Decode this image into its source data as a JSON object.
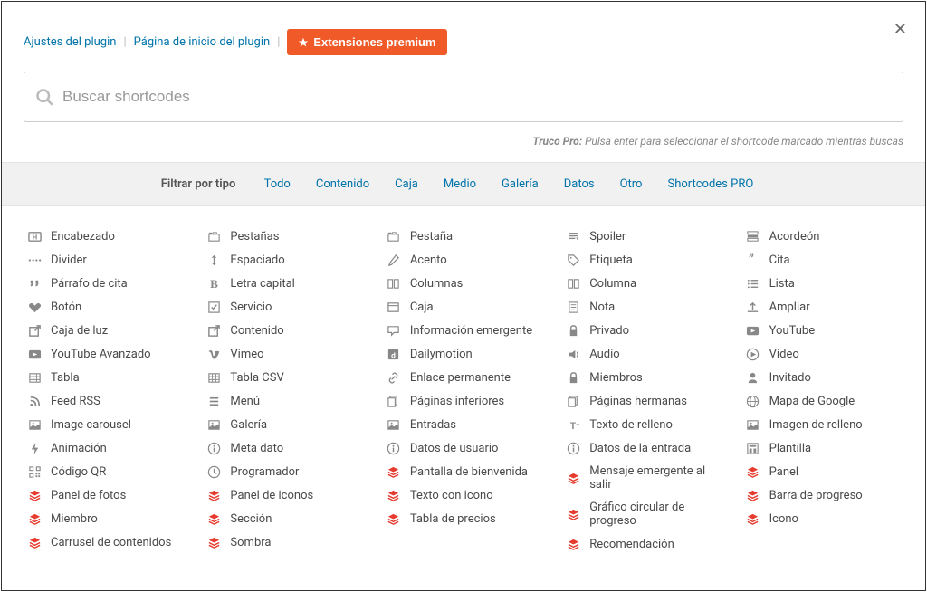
{
  "header": {
    "link_settings": "Ajustes del plugin",
    "link_home": "Página de inicio del plugin",
    "premium_button": "Extensiones premium",
    "search_placeholder": "Buscar shortcodes",
    "tip_label": "Truco Pro:",
    "tip_text": "Pulsa enter para seleccionar el shortcode marcado mientras buscas"
  },
  "filter": {
    "label": "Filtrar por tipo",
    "items": [
      "Todo",
      "Contenido",
      "Caja",
      "Medio",
      "Galería",
      "Datos",
      "Otro",
      "Shortcodes PRO"
    ]
  },
  "columns": [
    [
      {
        "icon": "heading",
        "label": "Encabezado"
      },
      {
        "icon": "divider",
        "label": "Divider"
      },
      {
        "icon": "quote",
        "label": "Párrafo de cita"
      },
      {
        "icon": "heart",
        "label": "Botón"
      },
      {
        "icon": "external",
        "label": "Caja de luz"
      },
      {
        "icon": "youtube",
        "label": "YouTube Avanzado"
      },
      {
        "icon": "table",
        "label": "Tabla"
      },
      {
        "icon": "rss",
        "label": "Feed RSS"
      },
      {
        "icon": "image",
        "label": "Image carousel"
      },
      {
        "icon": "bolt",
        "label": "Animación"
      },
      {
        "icon": "qr",
        "label": "Código QR"
      },
      {
        "icon": "layers",
        "label": "Panel de fotos",
        "red": true
      },
      {
        "icon": "layers",
        "label": "Miembro",
        "red": true
      },
      {
        "icon": "layers",
        "label": "Carrusel de contenidos",
        "red": true
      }
    ],
    [
      {
        "icon": "tabs",
        "label": "Pestañas"
      },
      {
        "icon": "vspace",
        "label": "Espaciado"
      },
      {
        "icon": "bold",
        "label": "Letra capital"
      },
      {
        "icon": "check",
        "label": "Servicio"
      },
      {
        "icon": "external",
        "label": "Contenido"
      },
      {
        "icon": "vimeo",
        "label": "Vimeo"
      },
      {
        "icon": "table",
        "label": "Tabla CSV"
      },
      {
        "icon": "menu",
        "label": "Menú"
      },
      {
        "icon": "image",
        "label": "Galería"
      },
      {
        "icon": "info",
        "label": "Meta dato"
      },
      {
        "icon": "clock",
        "label": "Programador"
      },
      {
        "icon": "layers",
        "label": "Panel de iconos",
        "red": true
      },
      {
        "icon": "layers",
        "label": "Sección",
        "red": true
      },
      {
        "icon": "layers",
        "label": "Sombra",
        "red": true
      }
    ],
    [
      {
        "icon": "tabs",
        "label": "Pestaña"
      },
      {
        "icon": "pencil",
        "label": "Acento"
      },
      {
        "icon": "columns",
        "label": "Columnas"
      },
      {
        "icon": "box",
        "label": "Caja"
      },
      {
        "icon": "comment",
        "label": "Información emergente"
      },
      {
        "icon": "dailymotion",
        "label": "Dailymotion"
      },
      {
        "icon": "link",
        "label": "Enlace permanente"
      },
      {
        "icon": "pages",
        "label": "Páginas inferiores"
      },
      {
        "icon": "image",
        "label": "Entradas"
      },
      {
        "icon": "info",
        "label": "Datos de usuario"
      },
      {
        "icon": "layers",
        "label": "Pantalla de bienvenida",
        "red": true
      },
      {
        "icon": "layers",
        "label": "Texto con icono",
        "red": true
      },
      {
        "icon": "layers",
        "label": "Tabla de precios",
        "red": true
      }
    ],
    [
      {
        "icon": "spoiler",
        "label": "Spoiler"
      },
      {
        "icon": "tag",
        "label": "Etiqueta"
      },
      {
        "icon": "columns",
        "label": "Columna"
      },
      {
        "icon": "note",
        "label": "Nota"
      },
      {
        "icon": "lock",
        "label": "Privado"
      },
      {
        "icon": "audio",
        "label": "Audio"
      },
      {
        "icon": "lock",
        "label": "Miembros"
      },
      {
        "icon": "pages",
        "label": "Páginas hermanas"
      },
      {
        "icon": "texticon",
        "label": "Texto de relleno"
      },
      {
        "icon": "info",
        "label": "Datos de la entrada"
      },
      {
        "icon": "layers",
        "label": "Mensaje emergente al salir",
        "red": true
      },
      {
        "icon": "layers",
        "label": "Gráfico circular de progreso",
        "red": true
      },
      {
        "icon": "layers",
        "label": "Recomendación",
        "red": true
      }
    ],
    [
      {
        "icon": "accordion",
        "label": "Acordeón"
      },
      {
        "icon": "quote2",
        "label": "Cita"
      },
      {
        "icon": "list",
        "label": "Lista"
      },
      {
        "icon": "expand",
        "label": "Ampliar"
      },
      {
        "icon": "youtube",
        "label": "YouTube"
      },
      {
        "icon": "video",
        "label": "Vídeo"
      },
      {
        "icon": "user",
        "label": "Invitado"
      },
      {
        "icon": "globe",
        "label": "Mapa de Google"
      },
      {
        "icon": "image",
        "label": "Imagen de relleno"
      },
      {
        "icon": "template",
        "label": "Plantilla"
      },
      {
        "icon": "layers",
        "label": "Panel",
        "red": true
      },
      {
        "icon": "layers",
        "label": "Barra de progreso",
        "red": true
      },
      {
        "icon": "layers",
        "label": "Icono",
        "red": true
      }
    ]
  ]
}
